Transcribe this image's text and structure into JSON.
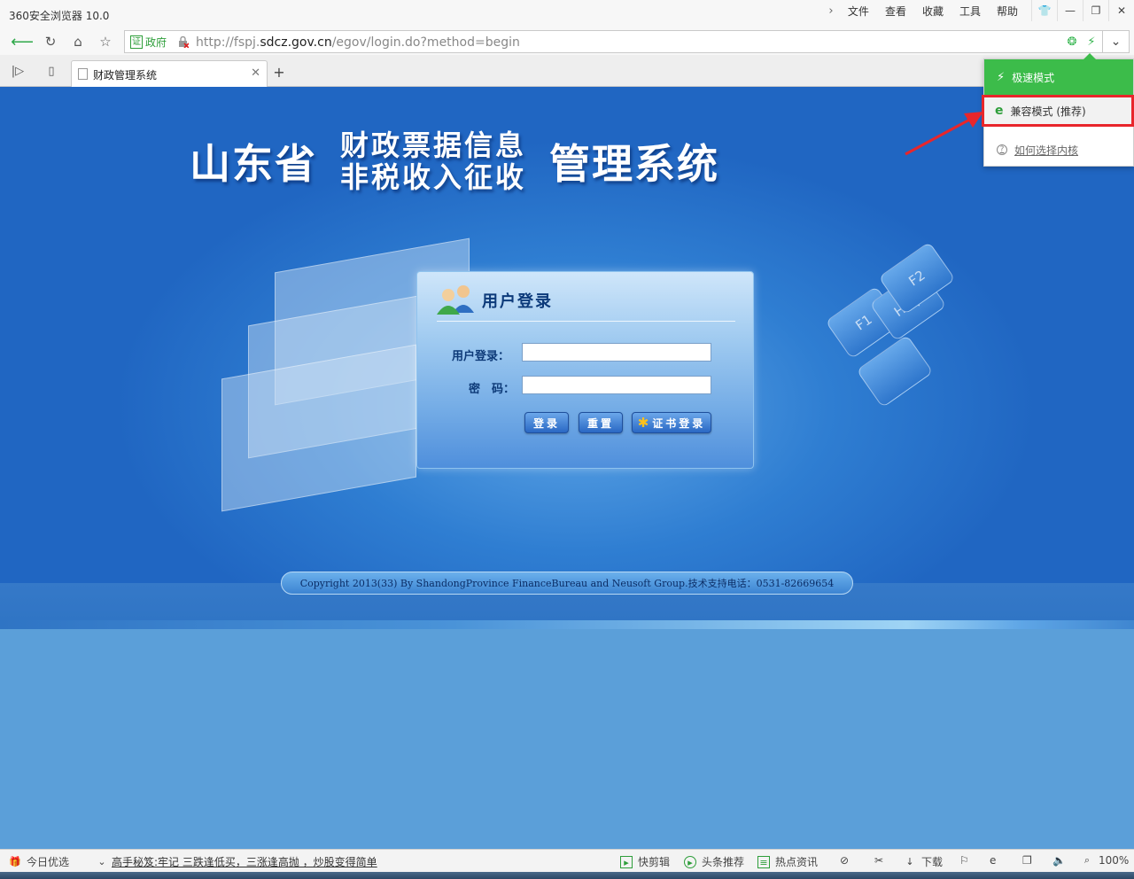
{
  "window": {
    "title": "360安全浏览器 10.0",
    "menu": [
      "文件",
      "查看",
      "收藏",
      "工具",
      "帮助"
    ]
  },
  "address": {
    "cert_label": "政府",
    "cert_badge": "证",
    "url_prefix": "http://fspj.",
    "url_host": "sdcz.gov.cn",
    "url_path": "/egov/login.do?method=begin"
  },
  "tab": {
    "title": "财政管理系统"
  },
  "page": {
    "headline_left": "山东省",
    "headline_stack": [
      "财政票据信息",
      "非税收入征收"
    ],
    "headline_right": "管理系统",
    "login": {
      "title": "用户登录",
      "username_label": "用户登录：",
      "password_label": "密　码：",
      "username_value": "",
      "password_value": "",
      "buttons": {
        "login": "登录",
        "reset": "重置",
        "cert_login": "证书登录"
      }
    },
    "decor": {
      "key_f1": "F1",
      "key_help": "Help",
      "key_f2": "F2"
    },
    "copyright": "Copyright 2013(33) By ShandongProvince FinanceBureau and Neusoft Group.技术支持电话：0531-82669654"
  },
  "kernel_menu": {
    "fast_mode": "极速模式",
    "compat_mode": "兼容模式 (推荐)",
    "how_to_choose": "如何选择内核"
  },
  "statusbar": {
    "today": "今日优选",
    "news": "高手秘笈:牢记 三跌逢低买，三涨逢高抛 ，炒股变得简单",
    "quick_cut": "快剪辑",
    "headlines": "头条推荐",
    "hot_news": "热点资讯",
    "download": "下载",
    "zoom": "100%"
  },
  "colors": {
    "accent_green": "#3cbc4a",
    "highlight_red": "#e8262b",
    "page_blue": "#2f7ed2"
  }
}
